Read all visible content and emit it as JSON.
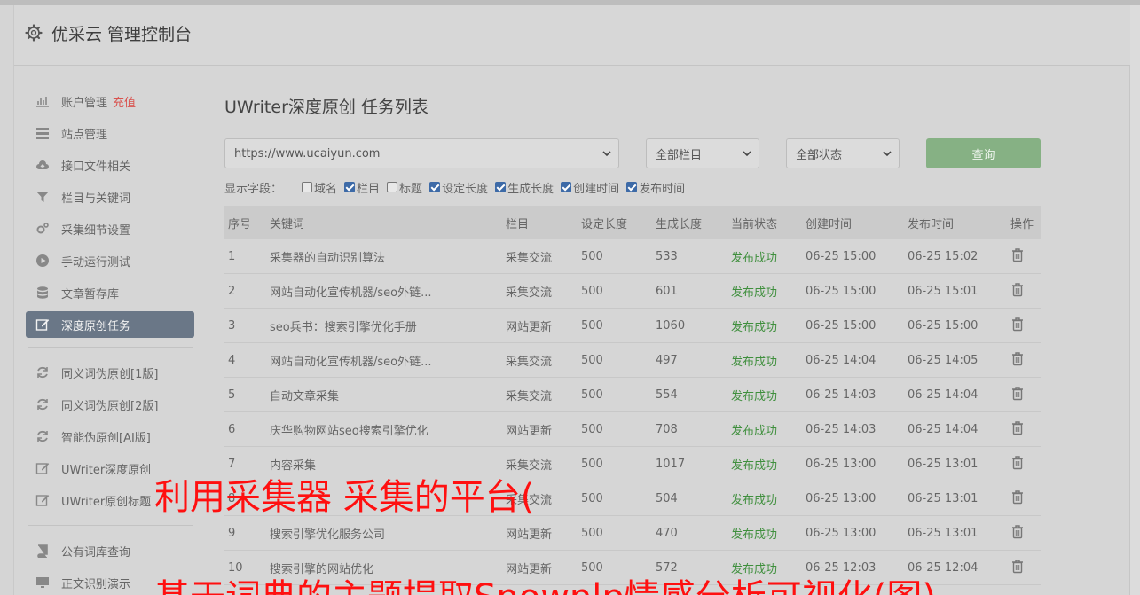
{
  "header": {
    "title": "优采云 管理控制台",
    "icon": "gear-icon"
  },
  "sidebar": {
    "group1": [
      {
        "label": "账户管理",
        "badge": "充值",
        "icon": "bar-chart-icon"
      },
      {
        "label": "站点管理",
        "icon": "server-icon"
      },
      {
        "label": "接口文件相关",
        "icon": "cloud-upload-icon"
      },
      {
        "label": "栏目与关键词",
        "icon": "filter-icon"
      },
      {
        "label": "采集细节设置",
        "icon": "gears-icon"
      },
      {
        "label": "手动运行测试",
        "icon": "play-circle-icon"
      },
      {
        "label": "文章暂存库",
        "icon": "database-icon"
      },
      {
        "label": "深度原创任务",
        "icon": "edit-icon",
        "active": true
      }
    ],
    "group2": [
      {
        "label": "同义词伪原创[1版]",
        "icon": "refresh-icon"
      },
      {
        "label": "同义词伪原创[2版]",
        "icon": "refresh-icon"
      },
      {
        "label": "智能伪原创[AI版]",
        "icon": "refresh-icon"
      },
      {
        "label": "UWriter深度原创",
        "icon": "edit-icon"
      },
      {
        "label": "UWriter原创标题",
        "icon": "edit-icon"
      }
    ],
    "group3": [
      {
        "label": "公有词库查询",
        "icon": "book-icon"
      },
      {
        "label": "正文识别演示",
        "icon": "monitor-icon"
      }
    ]
  },
  "main": {
    "title": "UWriter深度原创 任务列表",
    "filters": {
      "site": "https://www.ucaiyun.com",
      "column": "全部栏目",
      "status": "全部状态",
      "query_label": "查询"
    },
    "fields_label": "显示字段：",
    "fields": [
      {
        "label": "域名",
        "checked": false
      },
      {
        "label": "栏目",
        "checked": true
      },
      {
        "label": "标题",
        "checked": false
      },
      {
        "label": "设定长度",
        "checked": true
      },
      {
        "label": "生成长度",
        "checked": true
      },
      {
        "label": "创建时间",
        "checked": true
      },
      {
        "label": "发布时间",
        "checked": true
      }
    ],
    "table": {
      "headers": [
        "序号",
        "关键词",
        "栏目",
        "设定长度",
        "生成长度",
        "当前状态",
        "创建时间",
        "发布时间",
        "操作"
      ],
      "rows": [
        [
          "1",
          "采集器的自动识别算法",
          "采集交流",
          "500",
          "533",
          "发布成功",
          "06-25 15:00",
          "06-25 15:02"
        ],
        [
          "2",
          "网站自动化宣传机器/seo外链...",
          "采集交流",
          "500",
          "601",
          "发布成功",
          "06-25 15:00",
          "06-25 15:01"
        ],
        [
          "3",
          "seo兵书：搜索引擎优化手册",
          "网站更新",
          "500",
          "1060",
          "发布成功",
          "06-25 15:00",
          "06-25 15:00"
        ],
        [
          "4",
          "网站自动化宣传机器/seo外链...",
          "采集交流",
          "500",
          "497",
          "发布成功",
          "06-25 14:04",
          "06-25 14:05"
        ],
        [
          "5",
          "自动文章采集",
          "采集交流",
          "500",
          "554",
          "发布成功",
          "06-25 14:03",
          "06-25 14:04"
        ],
        [
          "6",
          "庆华购物网站seo搜索引擎优化",
          "网站更新",
          "500",
          "708",
          "发布成功",
          "06-25 14:03",
          "06-25 14:04"
        ],
        [
          "7",
          "内容采集",
          "采集交流",
          "500",
          "1017",
          "发布成功",
          "06-25 13:00",
          "06-25 13:01"
        ],
        [
          "8",
          "",
          "采集交流",
          "500",
          "504",
          "发布成功",
          "06-25 13:00",
          "06-25 13:01"
        ],
        [
          "9",
          "搜索引擎优化服务公司",
          "网站更新",
          "500",
          "470",
          "发布成功",
          "06-25 13:00",
          "06-25 13:01"
        ],
        [
          "10",
          "搜索引擎的网站优化",
          "网站更新",
          "500",
          "572",
          "发布成功",
          "06-25 12:03",
          "06-25 12:04"
        ]
      ]
    }
  },
  "overlay": {
    "line1": "利用采集器 采集的平台(",
    "line2": "基于词典的主题提取Snownlp情感分析可视化(图)"
  },
  "colors": {
    "success": "#3f8f3d",
    "query_button": "#86b184",
    "active_nav": "#6a7787",
    "overlay_text": "#ff1010",
    "badge": "#d9534f"
  }
}
